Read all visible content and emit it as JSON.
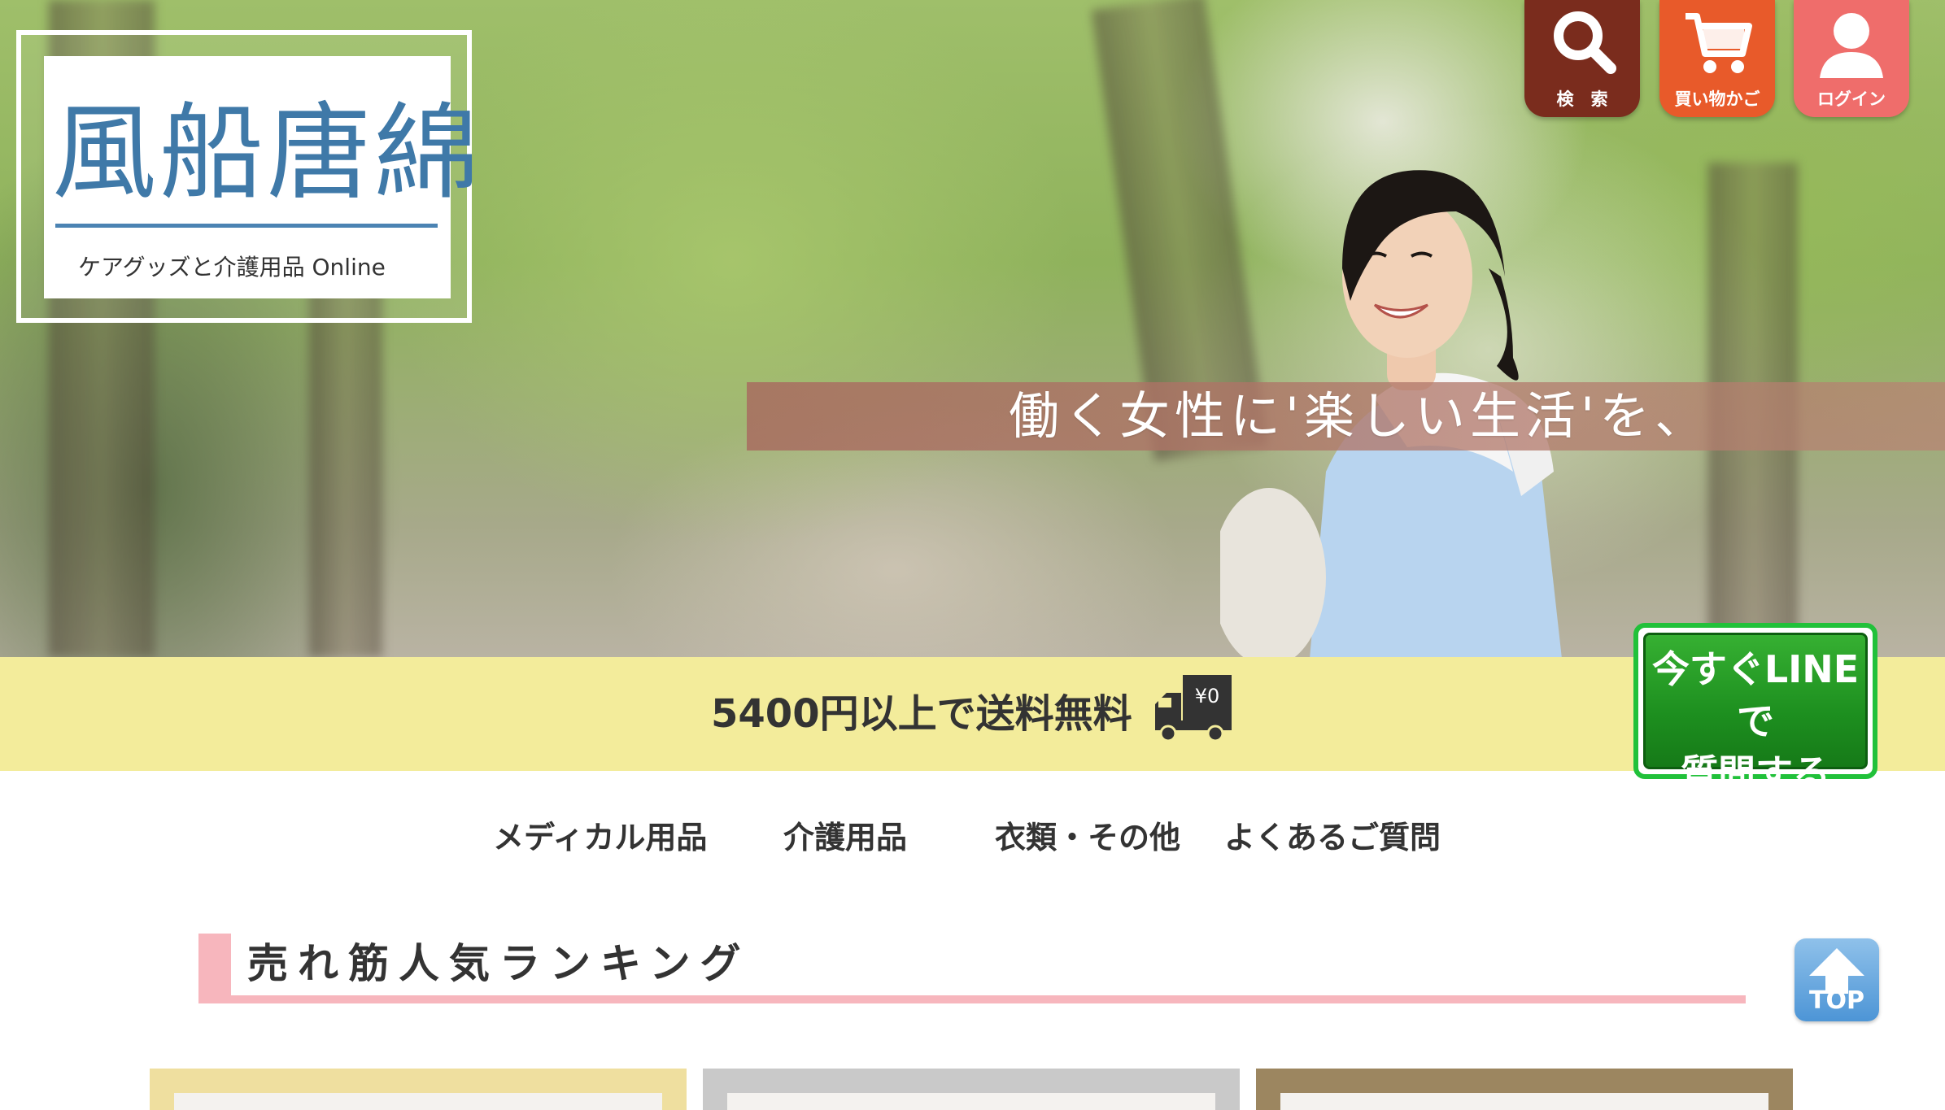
{
  "logo": {
    "kanji": "風船唐綿",
    "subtitle": "ケアグッズと介護用品 Online"
  },
  "header_icons": {
    "search_label": "検　索",
    "cart_label": "買い物かご",
    "login_label": "ログイン"
  },
  "hero": {
    "tagline": "働く女性に'楽しい生活'を、"
  },
  "shipping": {
    "text": "5400円以上で送料無料",
    "truck_badge": "¥0"
  },
  "line_button": {
    "line1": "今すぐLINEで",
    "line2": "質問する"
  },
  "nav": {
    "items": [
      "メディカル用品",
      "介護用品",
      "衣類・その他",
      "よくあるご質問"
    ]
  },
  "ranking": {
    "title": "売れ筋人気ランキング"
  },
  "top_button": {
    "label": "TOP"
  },
  "colors": {
    "shipping_band": "#f3ec9b",
    "ranking_accent": "#f7b6bd",
    "line_green": "#21c13a",
    "logo_blue": "#3f79a8",
    "search_icon_bg": "#7a2c1d",
    "cart_icon_bg": "#e85a2a",
    "login_icon_bg": "#ef6d6b",
    "top_button_blue": "#4d95d6"
  }
}
